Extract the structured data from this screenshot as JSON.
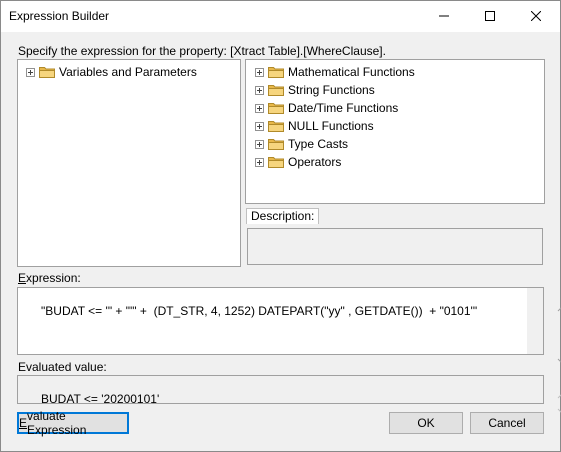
{
  "window": {
    "title": "Expression Builder"
  },
  "prompt": "Specify the expression for the property: [Xtract Table].[WhereClause].",
  "left_tree": [
    {
      "label": "Variables and Parameters"
    }
  ],
  "right_tree": [
    {
      "label": "Mathematical Functions"
    },
    {
      "label": "String Functions"
    },
    {
      "label": "Date/Time Functions"
    },
    {
      "label": "NULL Functions"
    },
    {
      "label": "Type Casts"
    },
    {
      "label": "Operators"
    }
  ],
  "description": {
    "label": "Description:",
    "value": ""
  },
  "expression": {
    "label_first": "E",
    "label_rest": "xpression:",
    "value": "\"BUDAT <= '\" + \"'\" +  (DT_STR, 4, 1252) DATEPART(\"yy\" , GETDATE())  + \"0101'\""
  },
  "evaluated": {
    "label": "Evaluated value:",
    "value": "BUDAT <= '20200101'"
  },
  "buttons": {
    "evaluate_first": "E",
    "evaluate_rest": "valuate Expression",
    "ok": "OK",
    "cancel": "Cancel"
  },
  "colors": {
    "accent": "#0078d7",
    "folder": "#e8b84a"
  },
  "icons": [
    "minimize-icon",
    "maximize-icon",
    "close-icon",
    "folder-icon",
    "expand-icon"
  ]
}
